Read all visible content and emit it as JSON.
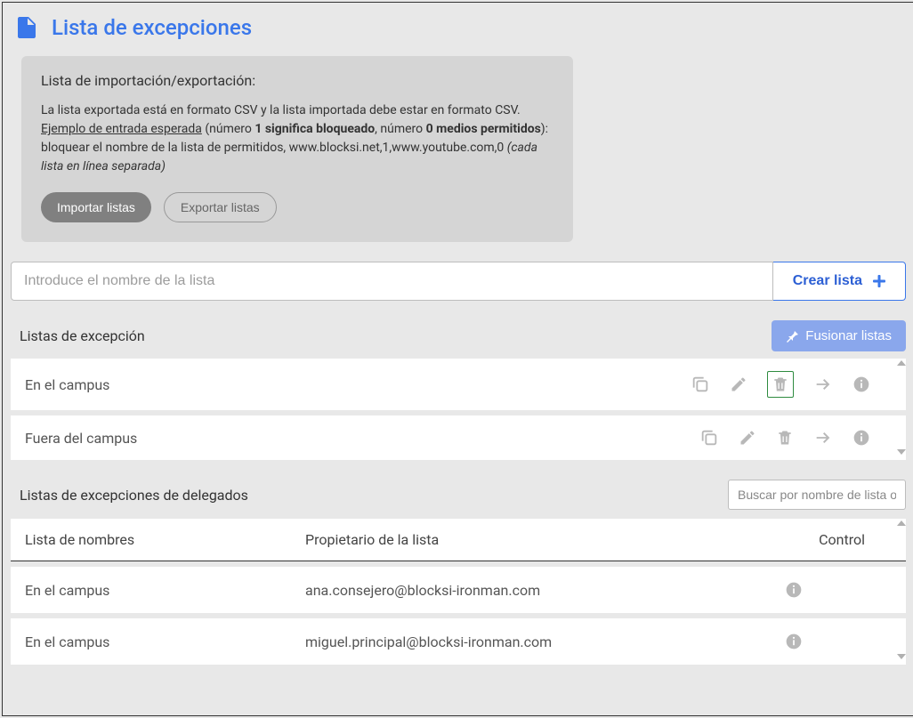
{
  "title": "Lista de excepciones",
  "card": {
    "heading": "Lista de importación/exportación:",
    "line1": "La lista exportada está en formato CSV y la lista importada debe estar en formato CSV.",
    "exampleLabel": "Ejemplo de entrada esperada",
    "numPrefix": " (número ",
    "bold1": "1 significa bloqueado",
    "middle": ", número ",
    "bold2": "0 medios permitidos",
    "afterBold": "): bloquear el nombre de la lista de permitidos, www.blocksi.net,1,www.youtube.com,0   ",
    "italicTail": "(cada lista en línea separada)",
    "importBtn": "Importar listas",
    "exportBtn": "Exportar listas"
  },
  "createInput": {
    "placeholder": "Introduce el nombre de la lista"
  },
  "createBtn": "Crear lista",
  "exceptionHeader": "Listas de excepción",
  "mergeBtn": "Fusionar listas",
  "lists": [
    {
      "name": "En el campus"
    },
    {
      "name": "Fuera del campus"
    }
  ],
  "delegateHeader": "Listas de excepciones de delegados",
  "searchPlaceholder": "Buscar por nombre de lista o p",
  "tableHead": {
    "col1": "Lista de nombres",
    "col2": "Propietario de la lista",
    "col3": "Control"
  },
  "delegates": [
    {
      "name": "En el campus",
      "owner": "ana.consejero@blocksi-ironman.com"
    },
    {
      "name": "En el campus",
      "owner": "miguel.principal@blocksi-ironman.com"
    }
  ]
}
